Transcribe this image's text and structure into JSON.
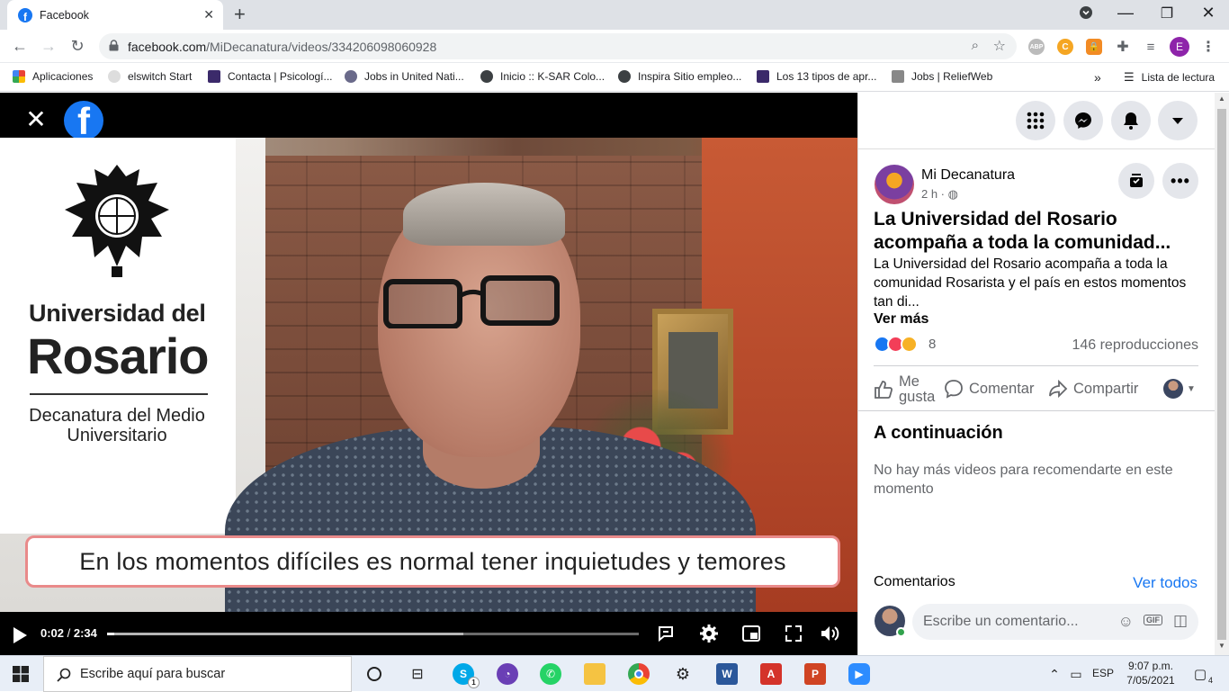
{
  "browser": {
    "tab_title": "Facebook",
    "url_domain": "facebook.com",
    "url_path": "/MiDecanatura/videos/334206098060928",
    "bookmarks": [
      {
        "label": "Aplicaciones",
        "color": "#4285f4"
      },
      {
        "label": "elswitch Start",
        "color": "#d0d0d0"
      },
      {
        "label": "Contacta | Psicologí...",
        "color": "#3b2a6a"
      },
      {
        "label": "Jobs in United Nati...",
        "color": "#6a6a8a"
      },
      {
        "label": "Inicio :: K-SAR Colo...",
        "color": "#3c4043"
      },
      {
        "label": "Inspira Sitio empleo...",
        "color": "#3c4043"
      },
      {
        "label": "Los 13 tipos de apr...",
        "color": "#3b2a6a"
      },
      {
        "label": "Jobs | ReliefWeb",
        "color": "#777"
      }
    ],
    "reading_list": "Lista de lectura",
    "profile_initial": "E",
    "more_bookmarks": "»"
  },
  "video": {
    "logo_line1": "Universidad del",
    "logo_line2": "Rosario",
    "logo_line3": "Decanatura del Medio Universitario",
    "caption": "En los momentos difíciles es normal tener inquietudes y temores",
    "time_current": "0:02",
    "time_total": "2:34",
    "progress_played": 0.013,
    "progress_buffered": 0.67
  },
  "post": {
    "page_name": "Mi Decanatura",
    "time": "2 h ·",
    "title": "La Universidad del Rosario acompaña a toda la comunidad...",
    "description": "La Universidad del Rosario acompaña a toda la comunidad Rosarista y el país en estos momentos tan di...",
    "see_more": "Ver más",
    "reaction_count": "8",
    "views": "146 reproducciones",
    "like_label_1": "Me",
    "like_label_2": "gusta",
    "comment_label": "Comentar",
    "share_label": "Compartir",
    "next_title": "A continuación",
    "next_empty": "No hay más videos para recomendarte en este momento",
    "comments_label": "Comentarios",
    "see_all": "Ver todos",
    "comment_placeholder": "Escribe un comentario..."
  },
  "taskbar": {
    "search_placeholder": "Escribe aquí para buscar",
    "lang": "ESP",
    "time": "9:07 p.m.",
    "date": "7/05/2021",
    "notifications": "4",
    "skype_badge": "1"
  },
  "colors": {
    "facebook_blue": "#1877f2",
    "progress_played": "#ffffff"
  }
}
